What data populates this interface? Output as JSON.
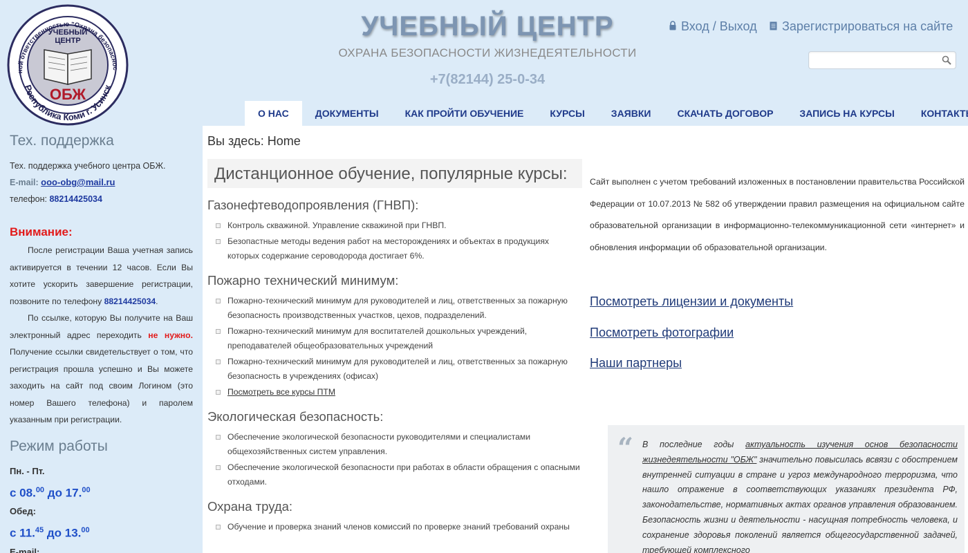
{
  "colors": {
    "header_bg": "#dcebf8",
    "nav_text": "#1f3a8a",
    "link": "#1f3aa0",
    "attention": "#e21b1b",
    "time": "#1f4fc8"
  },
  "logo": {
    "ring_text": "Общество с ограниченной ответственностью \"Охрана безопасности жизнедеятельности\"",
    "bottom_text": "Республика Коми г. Усинск",
    "inner_top1": "УЧЕБНЫЙ",
    "inner_top2": "ЦЕНТР",
    "inner_bottom": "ОБЖ"
  },
  "header": {
    "title": "УЧЕБНЫЙ ЦЕНТР",
    "subtitle": "ОХРАНА БЕЗОПАСНОСТИ ЖИЗНЕДЕЯТЕЛЬНОСТИ",
    "phone": "+7(82144) 25-0-34",
    "login_label": "Вход / Выход",
    "login_icon": "lock-icon",
    "register_label": "Зарегистрироваться на сайте",
    "register_icon": "document-icon",
    "search_placeholder": "",
    "search_icon": "search-icon"
  },
  "nav": {
    "items": [
      {
        "label": "О нас"
      },
      {
        "label": "Документы"
      },
      {
        "label": "Как пройти обучение"
      },
      {
        "label": "Курсы"
      },
      {
        "label": "Заявки"
      },
      {
        "label": "Скачать договор"
      },
      {
        "label": "Запись на курсы"
      },
      {
        "label": "Контакты"
      }
    ]
  },
  "sidebar": {
    "support_heading": "Тех. поддержка",
    "support_text": "Тех. поддержка учебного центра ОБЖ.",
    "email_label": "E-mail:",
    "email": "ooo-obg@mail.ru",
    "phone_label": "телефон:",
    "phone": "88214425034",
    "attention": "Внимание:",
    "para1_a": "После регистрации Ваша учетная запись активируется в течении 12 часов. Если Вы хотите ускорить завершение регистрации, позвоните по телефону ",
    "para1_phone": "88214425034",
    "para1_b": ".",
    "para2_a": "По ссылке, которую Вы получите на Ваш электронный адрес переходить ",
    "para2_red": "не нужно.",
    "para2_b": " Получение ссылки свидетельствует о том, что регистрация прошла успешно и Вы можете заходить на сайт под своим Логином (это номер Вашего телефона) и паролем указанным при регистрации.",
    "work_heading": "Режим работы",
    "days_label": "Пн. -  Пт.",
    "work_from": "с 08.",
    "work_from_sup": "00",
    "work_mid": " до 17.",
    "work_to_sup": "00",
    "lunch_label": "Обед:",
    "lunch_from": "с 11.",
    "lunch_from_sup": "45",
    "lunch_mid": " до 13.",
    "lunch_to_sup": "00",
    "email2_label": "E-mail:"
  },
  "main": {
    "breadcrumb": "Вы здесь: Home",
    "title": "Дистанционное обучение, популярные курсы:",
    "cat1": "Газонефтеводопроявления (ГНВП):",
    "cat1_items": [
      "Контроль скважиной. Управление скважиной при ГНВП.",
      "Безопастные методы ведения работ на месторождениях и объектах в продукциях которых содержание сероводорода достигает 6%."
    ],
    "cat2": "Пожарно технический минимум:",
    "cat2_items": [
      "Пожарно-технический минимум для руководителей и лиц, ответственных за пожарную безопасность производственных участков, цехов, подразделений.",
      "Пожарно-технический минимум для воспитателей дошкольных учреждений, преподавателей общеобразовательных учреждений",
      "Пожарно-технический минимум для руководителей и лиц, ответственных за пожарную безопасность в учреждениях (офисах)"
    ],
    "cat2_more": "Посмотреть все курсы ПТМ",
    "cat3": "Экологическая безопасность:",
    "cat3_items": [
      "Обеспечение экологической безопасности руководителями и специалистами общехозяйственных систем управления.",
      "Обеспечение экологической безопасности при работах в области обращения с опасными отходами."
    ],
    "cat4": "Охрана труда:",
    "cat4_items": [
      "Обучение и проверка знаний членов комиссий по проверке знаний требований охраны"
    ]
  },
  "right": {
    "legal": "Сайт выполнен с учетом требований изложенных в постановлении правительства Российской Федерации от 10.07.2013 №  582 об утверждении правил размещения на официальном сайте образовательной организации в информационно-телекоммуникационной сети «интернет» и обновления информации об образовательной организации.",
    "link1": "Посмотреть лицензии и документы",
    "link2": "Посмотреть фотографии",
    "link3": "Наши партнеры",
    "quote_mark": "“",
    "quote_a": "В последние годы ",
    "quote_link": "актуальность изучения основ безопасности жизнедеятельности \"ОБЖ\"",
    "quote_b": " значительно повысилась всвязи с обострением внутренней ситуации в стране и угроз международного терроризма, что нашло отражение в соответствующих указаниях президента РФ, законодательстве, нормативных актах органов управления образованием. Безопасность жизни и деятельности - насущная потребность человека, и сохранение здоровья поколений является общегосударственной задачей, требующей комплексного"
  }
}
